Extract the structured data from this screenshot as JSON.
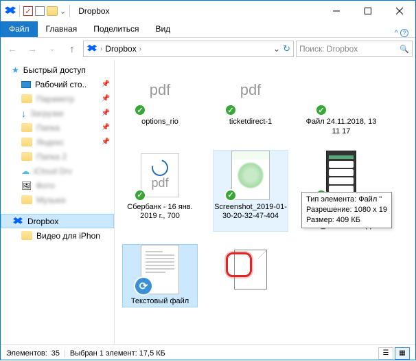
{
  "window": {
    "title": "Dropbox"
  },
  "menu": {
    "file": "Файл",
    "home": "Главная",
    "share": "Поделиться",
    "view": "Вид"
  },
  "addr": {
    "crumb1": "Dropbox",
    "sep": "›",
    "refresh": "↻"
  },
  "search": {
    "placeholder": "Поиск: Dropbox",
    "icon": "🔍"
  },
  "sidebar": {
    "quick": "Быстрый доступ",
    "desktop": "Рабочий сто..",
    "blurred": [
      "Параметр",
      "Загрузки",
      "Папка",
      "Яндекс",
      "Папка 2",
      "iCloud Drv",
      "Фото",
      "Музыка"
    ],
    "dropbox": "Dropbox",
    "video": "Видео для iPhon"
  },
  "files": {
    "f0": "options_rio",
    "f1": "ticketdirect-1",
    "f2": "Файл 24.11.2018, 13 11 17",
    "f3": "Сбербанк - 16 янв. 2019 г., 700",
    "f4": "Screenshot_2019-01-30-20-32-47-404",
    "f5": "Screenshot_2019-02-03-20-36-02-009_com.whatsapp",
    "f6": "Текстовый файл",
    "pdf": "pdf"
  },
  "tooltip": {
    "l1": "Тип элемента: Файл \"",
    "l2": "Разрешение: 1080 x 19",
    "l3": "Размер: 409 КБ"
  },
  "status": {
    "count_label": "Элементов:",
    "count": "35",
    "sel": "Выбран 1 элемент: 17,5 КБ"
  }
}
